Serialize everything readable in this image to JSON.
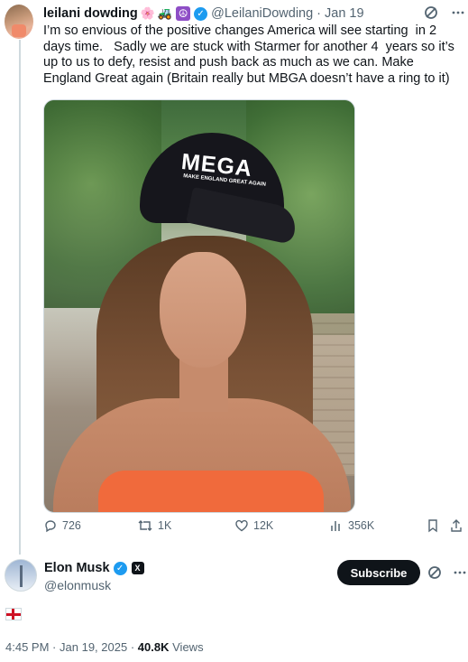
{
  "tweet": {
    "author_name": "leilani dowding",
    "emoji_badges": [
      "🌸",
      "🚜"
    ],
    "peace_badge": "☮",
    "verified_icon": "verified-badge",
    "handle": "@LeilaniDowding",
    "separator": "·",
    "date": "Jan 19",
    "text": "I’m so envious of the positive changes America will see starting  in 2 days time.   Sadly we are stuck with Starmer for another 4  years so it’s up to us to defy, resist and push back as much as we can. Make England Great again (Britain really but MBGA doesn’t have a ring to it)",
    "photo": {
      "cap_text": "MEGA",
      "cap_subtext": "MAKE ENGLAND GREAT AGAIN"
    },
    "metrics": {
      "replies": "726",
      "reposts": "1K",
      "likes": "12K",
      "views": "356K"
    },
    "icons": {
      "grok": "grok-icon",
      "more": "more-icon",
      "reply": "reply-icon",
      "repost": "repost-icon",
      "like": "heart-icon",
      "views": "views-icon",
      "bookmark": "bookmark-icon",
      "share": "share-icon"
    }
  },
  "reply": {
    "author_name": "Elon Musk",
    "handle": "@elonmusk",
    "subscribe_label": "Subscribe",
    "affiliate_badge": "X",
    "content": "england-flag-emoji",
    "time": "4:45 PM",
    "separator": "·",
    "date": "Jan 19, 2025",
    "separator2": "·",
    "views_count": "40.8K",
    "views_label": "Views"
  },
  "colors": {
    "text": "#0f1419",
    "secondary": "#536471",
    "verified": "#1d9bf0",
    "border": "#cfd9de",
    "button_bg": "#0f1419"
  }
}
